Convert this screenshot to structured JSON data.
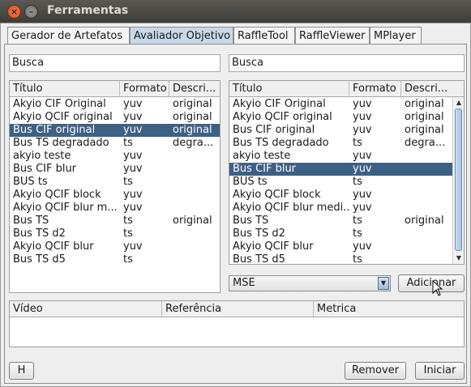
{
  "window": {
    "title": "Ferramentas"
  },
  "tabs": [
    "Gerador de Artefatos",
    "Avaliador Objetivo",
    "RaffleTool",
    "RaffleViewer",
    "MPlayer"
  ],
  "active_tab": 1,
  "left": {
    "search_value": "Busca",
    "columns": [
      "Título",
      "Formato",
      "Descri..."
    ],
    "selected_row": 2,
    "rows": [
      [
        "Akyio CIF Original",
        "yuv",
        "original"
      ],
      [
        "Akyio QCIF original",
        "yuv",
        "original"
      ],
      [
        "Bus CIF original",
        "yuv",
        "original"
      ],
      [
        "Bus TS degradado",
        "ts",
        "degra..."
      ],
      [
        "akyio teste",
        "yuv",
        ""
      ],
      [
        "Bus CIF blur",
        "yuv",
        ""
      ],
      [
        "BUS ts",
        "ts",
        ""
      ],
      [
        "Akyio QCIF block",
        "yuv",
        ""
      ],
      [
        "Akyio QCIF blur m...",
        "yuv",
        ""
      ],
      [
        "Bus TS",
        "ts",
        "original"
      ],
      [
        "Bus TS d2",
        "ts",
        ""
      ],
      [
        "Akyio QCIF blur",
        "yuv",
        ""
      ],
      [
        "Bus TS d5",
        "ts",
        ""
      ]
    ]
  },
  "right": {
    "search_value": "Busca",
    "columns": [
      "Título",
      "Formato",
      "Descri..."
    ],
    "selected_row": 5,
    "rows": [
      [
        "Akyio CIF Original",
        "yuv",
        "original"
      ],
      [
        "Akyio QCIF original",
        "yuv",
        "original"
      ],
      [
        "Bus CIF original",
        "yuv",
        "original"
      ],
      [
        "Bus TS degradado",
        "ts",
        "degra..."
      ],
      [
        "akyio teste",
        "yuv",
        ""
      ],
      [
        "Bus CIF blur",
        "yuv",
        ""
      ],
      [
        "BUS ts",
        "ts",
        ""
      ],
      [
        "Akyio QCIF block",
        "yuv",
        ""
      ],
      [
        "Akyio QCIF blur medi...",
        "yuv",
        ""
      ],
      [
        "Bus TS",
        "ts",
        "original"
      ],
      [
        "Bus TS d2",
        "ts",
        ""
      ],
      [
        "Akyio QCIF blur",
        "yuv",
        ""
      ],
      [
        "Bus TS d5",
        "ts",
        ""
      ]
    ],
    "metric_value": "MSE",
    "add_label": "Adicionar"
  },
  "results": {
    "columns": [
      "Vídeo",
      "Referência",
      "Metrica"
    ]
  },
  "buttons": {
    "h": "H",
    "remove": "Remover",
    "start": "Iniciar"
  },
  "colors": {
    "selection": "#3d6185",
    "active_tab": "#c8d9e9",
    "titlebar": "#3d3c38"
  }
}
